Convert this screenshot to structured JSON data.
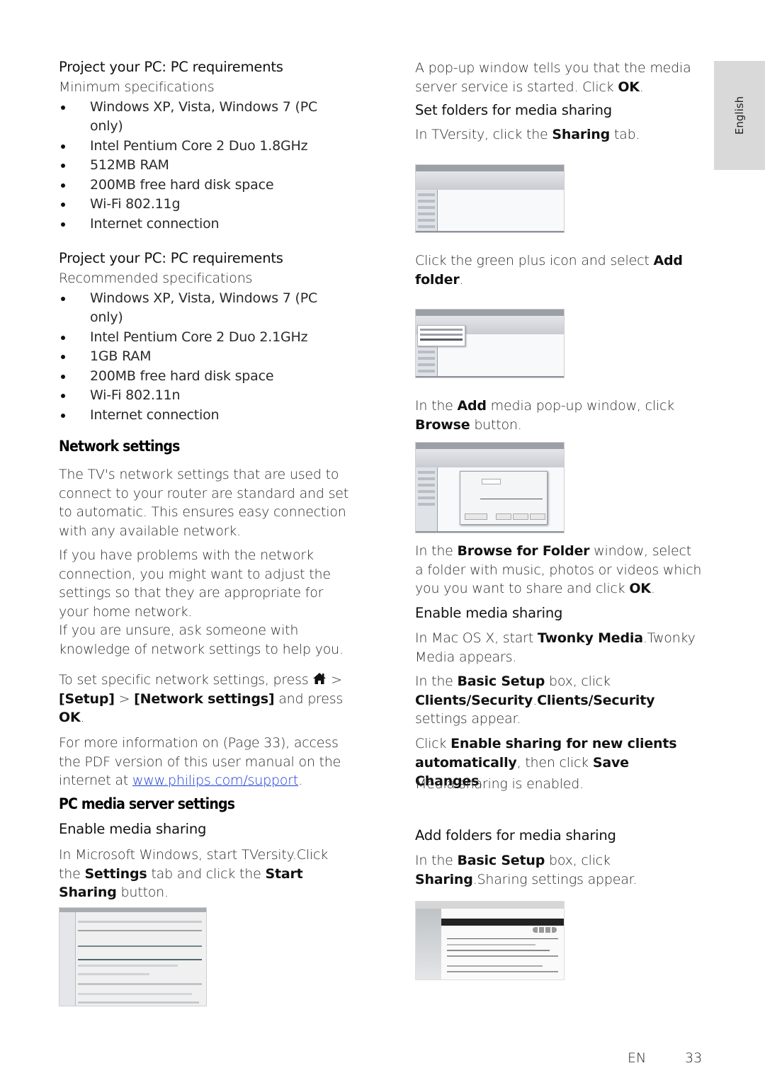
{
  "sidebar_tab": {
    "label": "English"
  },
  "left": {
    "min_req": {
      "title": "Project your PC: PC requirements",
      "subtitle": "Minimum specifications",
      "items": [
        "Windows XP, Vista, Windows 7 (PC only)",
        "Intel Pentium Core 2 Duo 1.8GHz",
        "512MB RAM",
        "200MB free hard disk space",
        "Wi-Fi 802.11g",
        "Internet connection"
      ]
    },
    "rec_req": {
      "title": "Project your PC: PC requirements",
      "subtitle": "Recommended specifications",
      "items": [
        "Windows XP, Vista, Windows 7 (PC only)",
        "Intel Pentium Core 2 Duo 2.1GHz",
        "1GB RAM",
        "200MB free hard disk space",
        "Wi-Fi 802.11n",
        "Internet connection"
      ]
    },
    "network": {
      "heading": "Network settings",
      "para1": "The TV's network settings that are used to connect to your router are standard and set to automatic. This ensures easy connection with any available network.",
      "para2": "If you have problems with the network connection, you might want to adjust the settings so that they are appropriate for your home network.",
      "para3": "If you are unsure, ask someone with knowledge of network settings to help you.",
      "para4_prefix": "To set specific network settings, press",
      "para4_icon": "home-icon",
      "para4_sep1": ">",
      "para4_setup": "[Setup]",
      "para4_sep2": ">",
      "para4_network": "[Network settings]",
      "para4_mid": "and press",
      "para4_ok": "OK",
      "para4_end": ".",
      "para5_prefix": "For more information on   (Page 33), access the PDF version of this user manual on the internet at",
      "para5_link": "www.philips.com/support",
      "para5_end": "."
    },
    "pc_media": {
      "heading": "PC media server settings",
      "subheading": "Enable media sharing",
      "p1_a": "In Microsoft Windows, start TVersity.Click the",
      "p1_settings": "Settings",
      "p1_b": "tab and click the",
      "p1_start": "Start Sharing",
      "p1_c": "button.",
      "screenshot": "tversity-settings-screenshot"
    }
  },
  "right": {
    "p_popup_a": "A pop-up window tells you that the media server service is started. Click",
    "p_popup_ok": "OK",
    "p_popup_end": ".",
    "set_folders_heading": "Set folders for media sharing",
    "p_sharing_a": "In TVersity, click the",
    "p_sharing_b": "Sharing",
    "p_sharing_c": "tab.",
    "screenshot1": "tversity-sharing-tab-screenshot",
    "p_plus_a": "Click the green plus icon and select",
    "p_plus_b": "Add folder",
    "p_plus_c": ".",
    "screenshot2": "tversity-add-folder-screenshot",
    "p_add_a": "In the",
    "p_add_b": "Add",
    "p_add_c": "media pop-up window, click",
    "p_add_d": "Browse",
    "p_add_e": "button.",
    "screenshot3": "tversity-add-media-popup-screenshot",
    "p_browse_a": "In the",
    "p_browse_b": "Browse for Folder",
    "p_browse_c": "window, select a folder with music, photos or videos which you you want to share and click",
    "p_browse_ok": "OK",
    "p_browse_end": ".",
    "enable_heading": "Enable media sharing",
    "p_mac_a": "In Mac OS X, start",
    "p_mac_b": "Twonky Media",
    "p_mac_c": ".Twonky Media appears.",
    "p_basic_a": "In the",
    "p_basic_b": "Basic Setup",
    "p_basic_c": "box, click",
    "p_basic_d": "Clients/Security",
    "p_basic_e": ".",
    "p_basic_f": "Clients/Security",
    "p_basic_g": "settings appear.",
    "p_click_a": "Click",
    "p_click_b": "Enable sharing for new clients automatically",
    "p_click_c": ", then click",
    "p_click_d": "Save Changes",
    "p_click_e": ".",
    "p_enabled": "Media sharing is enabled.",
    "add_folders_heading": "Add folders for media sharing",
    "p_share_a": "In the",
    "p_share_b": "Basic Setup",
    "p_share_c": "box, click",
    "p_share_d": "Sharing",
    "p_share_e": ".Sharing settings appear.",
    "screenshot4": "twonky-sharing-screenshot"
  },
  "footer": {
    "lang": "EN",
    "page": "33"
  }
}
